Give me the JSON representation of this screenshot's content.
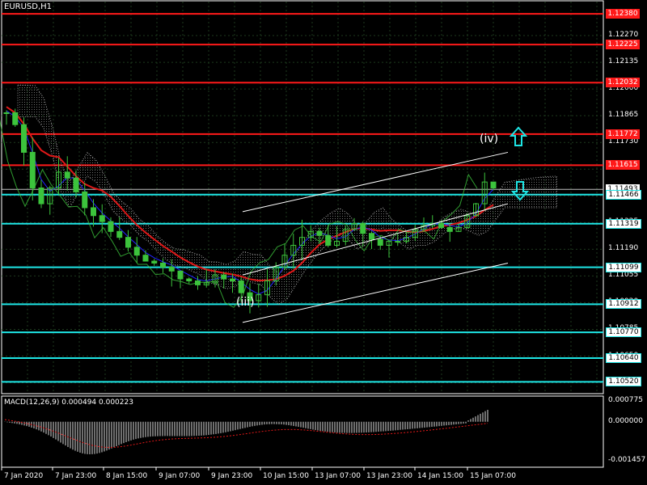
{
  "window": {
    "symbol_title": "EURUSD,H1",
    "macd_title": "MACD(12,26,9) 0.000494 0.000223"
  },
  "price_axis": {
    "labels": [
      "1.12270",
      "1.12135",
      "1.12000",
      "1.11865",
      "1.11730",
      "1.11595",
      "1.11460",
      "1.11325",
      "1.11190",
      "1.11055",
      "1.10920",
      "1.10785",
      "1.10650",
      "1.10515"
    ],
    "tags": [
      {
        "text": "1.12380",
        "kind": "resistance"
      },
      {
        "text": "1.12225",
        "kind": "resistance"
      },
      {
        "text": "1.12032",
        "kind": "resistance"
      },
      {
        "text": "1.11772",
        "kind": "resistance"
      },
      {
        "text": "1.11615",
        "kind": "resistance"
      },
      {
        "text": "1.11493",
        "kind": "current"
      },
      {
        "text": "1.11466",
        "kind": "support"
      },
      {
        "text": "1.11319",
        "kind": "support"
      },
      {
        "text": "1.11099",
        "kind": "support"
      },
      {
        "text": "1.10912",
        "kind": "support"
      },
      {
        "text": "1.10770",
        "kind": "support"
      },
      {
        "text": "1.10640",
        "kind": "support"
      },
      {
        "text": "1.10520",
        "kind": "support"
      }
    ]
  },
  "macd_axis": {
    "labels": [
      "0.000775",
      "0.000000",
      "-0.001457"
    ]
  },
  "time_axis": {
    "labels": [
      "7 Jan 2020",
      "7 Jan 23:00",
      "8 Jan 15:00",
      "9 Jan 07:00",
      "9 Jan 23:00",
      "10 Jan 15:00",
      "13 Jan 07:00",
      "13 Jan 23:00",
      "14 Jan 15:00",
      "15 Jan 07:00"
    ]
  },
  "annotations": {
    "wave_iii": "(iii)",
    "wave_iv": "(iv)"
  },
  "colors": {
    "background": "#000000",
    "grid": "#1e3a1e",
    "candles": "#3cc33c",
    "resistance": "#ff1a1a",
    "support": "#1ee6e6",
    "ma_red": "#e01818",
    "ma_blue": "#2222ff",
    "channel": "#ffffff",
    "cloud": "#b0b0b0",
    "current_price": "#c0c0c0"
  },
  "chart_data": {
    "type": "candlestick",
    "symbol": "EURUSD",
    "timeframe": "H1",
    "price_range": [
      1.1046,
      1.1245
    ],
    "series": [
      {
        "values": [
          1.1188,
          1.1182,
          1.1168,
          1.115,
          1.1142,
          1.115,
          1.1158,
          1.1155,
          1.1148,
          1.114,
          1.1136,
          1.1133,
          1.1128,
          1.1125,
          1.112,
          1.1116,
          1.1113,
          1.1112,
          1.111,
          1.1108,
          1.1104,
          1.1103,
          1.1101,
          1.1102,
          1.1106,
          1.1104,
          1.1103,
          1.1097,
          1.1093,
          1.1096,
          1.1103,
          1.111,
          1.1116,
          1.1121,
          1.1125,
          1.1128,
          1.1126,
          1.1121,
          1.1123,
          1.1129,
          1.1132,
          1.1127,
          1.1124,
          1.1121,
          1.1123,
          1.1123,
          1.1125,
          1.1129,
          1.1131,
          1.1132,
          1.113,
          1.1128,
          1.113,
          1.1136,
          1.1142,
          1.1153,
          1.115
        ]
      }
    ],
    "macd": {
      "range": [
        -0.001457,
        0.000775
      ],
      "macd_value": 0.000494,
      "signal_value": 0.000223
    }
  }
}
